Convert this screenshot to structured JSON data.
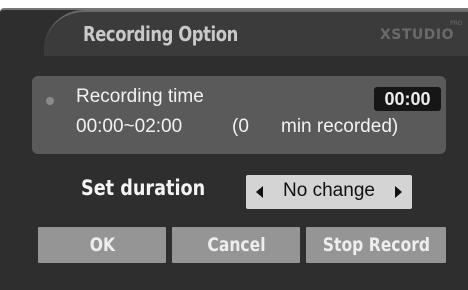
{
  "dialog": {
    "title": "Recording Option",
    "brand": "XSTUDIO",
    "brand_sup": "PRO"
  },
  "recording": {
    "label": "Recording time",
    "elapsed": "00:00",
    "range": "00:00~02:00",
    "minutes_recorded": "(0",
    "minutes_suffix": "min recorded)"
  },
  "duration": {
    "label": "Set duration",
    "value": "No change"
  },
  "buttons": {
    "ok": "OK",
    "cancel": "Cancel",
    "stop_record": "Stop Record"
  },
  "colors": {
    "dialog_bg": "#2e2e2e",
    "panel_bg": "#5a5a5a",
    "button_bg": "#959595",
    "selector_bg": "#d4d4d4"
  }
}
